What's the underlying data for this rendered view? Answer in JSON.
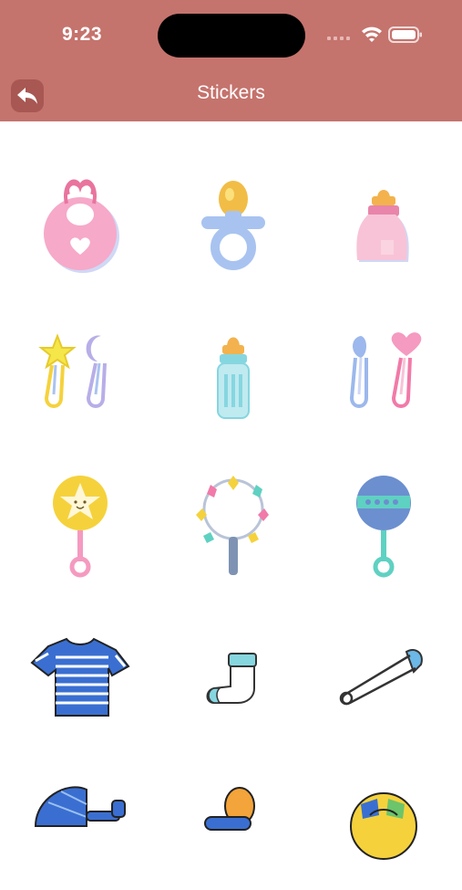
{
  "status_bar": {
    "time": "9:23"
  },
  "header": {
    "title": "Stickers"
  },
  "stickers": [
    {
      "name": "bib"
    },
    {
      "name": "pacifier"
    },
    {
      "name": "baby-bottle-pink"
    },
    {
      "name": "safety-pins-star-moon"
    },
    {
      "name": "baby-bottle-blue"
    },
    {
      "name": "safety-pins-heart"
    },
    {
      "name": "star-rattle"
    },
    {
      "name": "ring-rattle"
    },
    {
      "name": "ball-rattle"
    },
    {
      "name": "striped-shirt"
    },
    {
      "name": "baby-sock"
    },
    {
      "name": "safety-pin"
    },
    {
      "name": "stroller"
    },
    {
      "name": "pacifier-orange"
    },
    {
      "name": "ball"
    }
  ],
  "colors": {
    "header": "#c5736d",
    "back_button": "#a85752"
  }
}
